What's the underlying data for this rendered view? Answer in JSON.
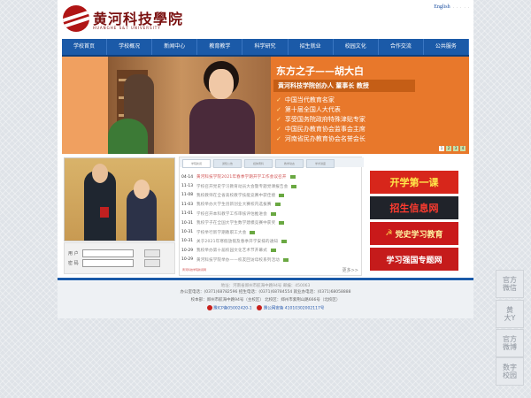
{
  "header": {
    "logo_cn": "黄河科技學院",
    "logo_en": "HUANGHE S&T UNIVERSITY",
    "english_link": "English",
    "toplinks": [
      "·",
      "·",
      "·",
      "·",
      "·"
    ]
  },
  "nav": {
    "items": [
      "学校首页",
      "学校概况",
      "新闻中心",
      "教育教学",
      "科学研究",
      "招生就业",
      "校园文化",
      "合作交流",
      "公共服务"
    ]
  },
  "banner": {
    "title": "东方之子——胡大白",
    "subtitle": "黄河科技学院创办人 董事长 教授",
    "bullets": [
      "中国当代教育名家",
      "第十届全国人大代表",
      "享受国务院政府特殊津贴专家",
      "中国民办教育协会监事会主席",
      "河南省民办教育协会名誉会长"
    ],
    "pager": [
      "1",
      "2",
      "3",
      "4"
    ]
  },
  "login": {
    "user_label": "用 户",
    "pass_label": "密 码"
  },
  "news": {
    "tabs": [
      "学院新闻",
      "通知公告",
      "媒体黄科",
      "教学动态",
      "学术讲座"
    ],
    "items": [
      {
        "date": "04-14",
        "title": "黄河科技学院2021年春季学期开学工作会议召开"
      },
      {
        "date": "11-13",
        "title": "学校召开党史学习教育动员大会暨专题党课报告会"
      },
      {
        "date": "11-08",
        "title": "我校教师在全省高校教学技能竞赛中获佳绩"
      },
      {
        "date": "11-03",
        "title": "我校举办大学生创新创业大赛校内选拔赛"
      },
      {
        "date": "11-01",
        "title": "学校召开本科教学工作审核评估推进会"
      },
      {
        "date": "10-31",
        "title": "我校学子在全国大学生数学建模竞赛中获奖"
      },
      {
        "date": "10-31",
        "title": "学校举行新学期教职工大会"
      },
      {
        "date": "10-31",
        "title": "关于2021年寒假放假及春季开学安排的通知"
      },
      {
        "date": "10-29",
        "title": "我校举办第十届校园文化艺术节开幕式"
      },
      {
        "date": "10-29",
        "title": "黄河科技学院举办——校友回访母校系列活动"
      }
    ],
    "more": "更多>>",
    "footnote": "黄河科技学院新闻网"
  },
  "features": [
    "开学第一课",
    "招生信息网",
    "党史学习教育",
    "学习强国专题网"
  ],
  "footer": {
    "address": "地址：河南省郑州市航海中路94号  邮编：450063",
    "phones": "办公室电话：(0371)68782596  招生电话：(0371)68784554  就业办电话：(0371)68058888",
    "campus": "校本部：郑州市航海中路94号（主校区）  北校区：郑州市紫荆山路666号（北校区）",
    "icp_label": "豫ICP备05002420-1",
    "police_label": "豫公网安备 41010302002117号"
  },
  "side_buttons": [
    "官方\n微信",
    "黄\n大Y",
    "官方\n微博",
    "数字\n校园"
  ]
}
